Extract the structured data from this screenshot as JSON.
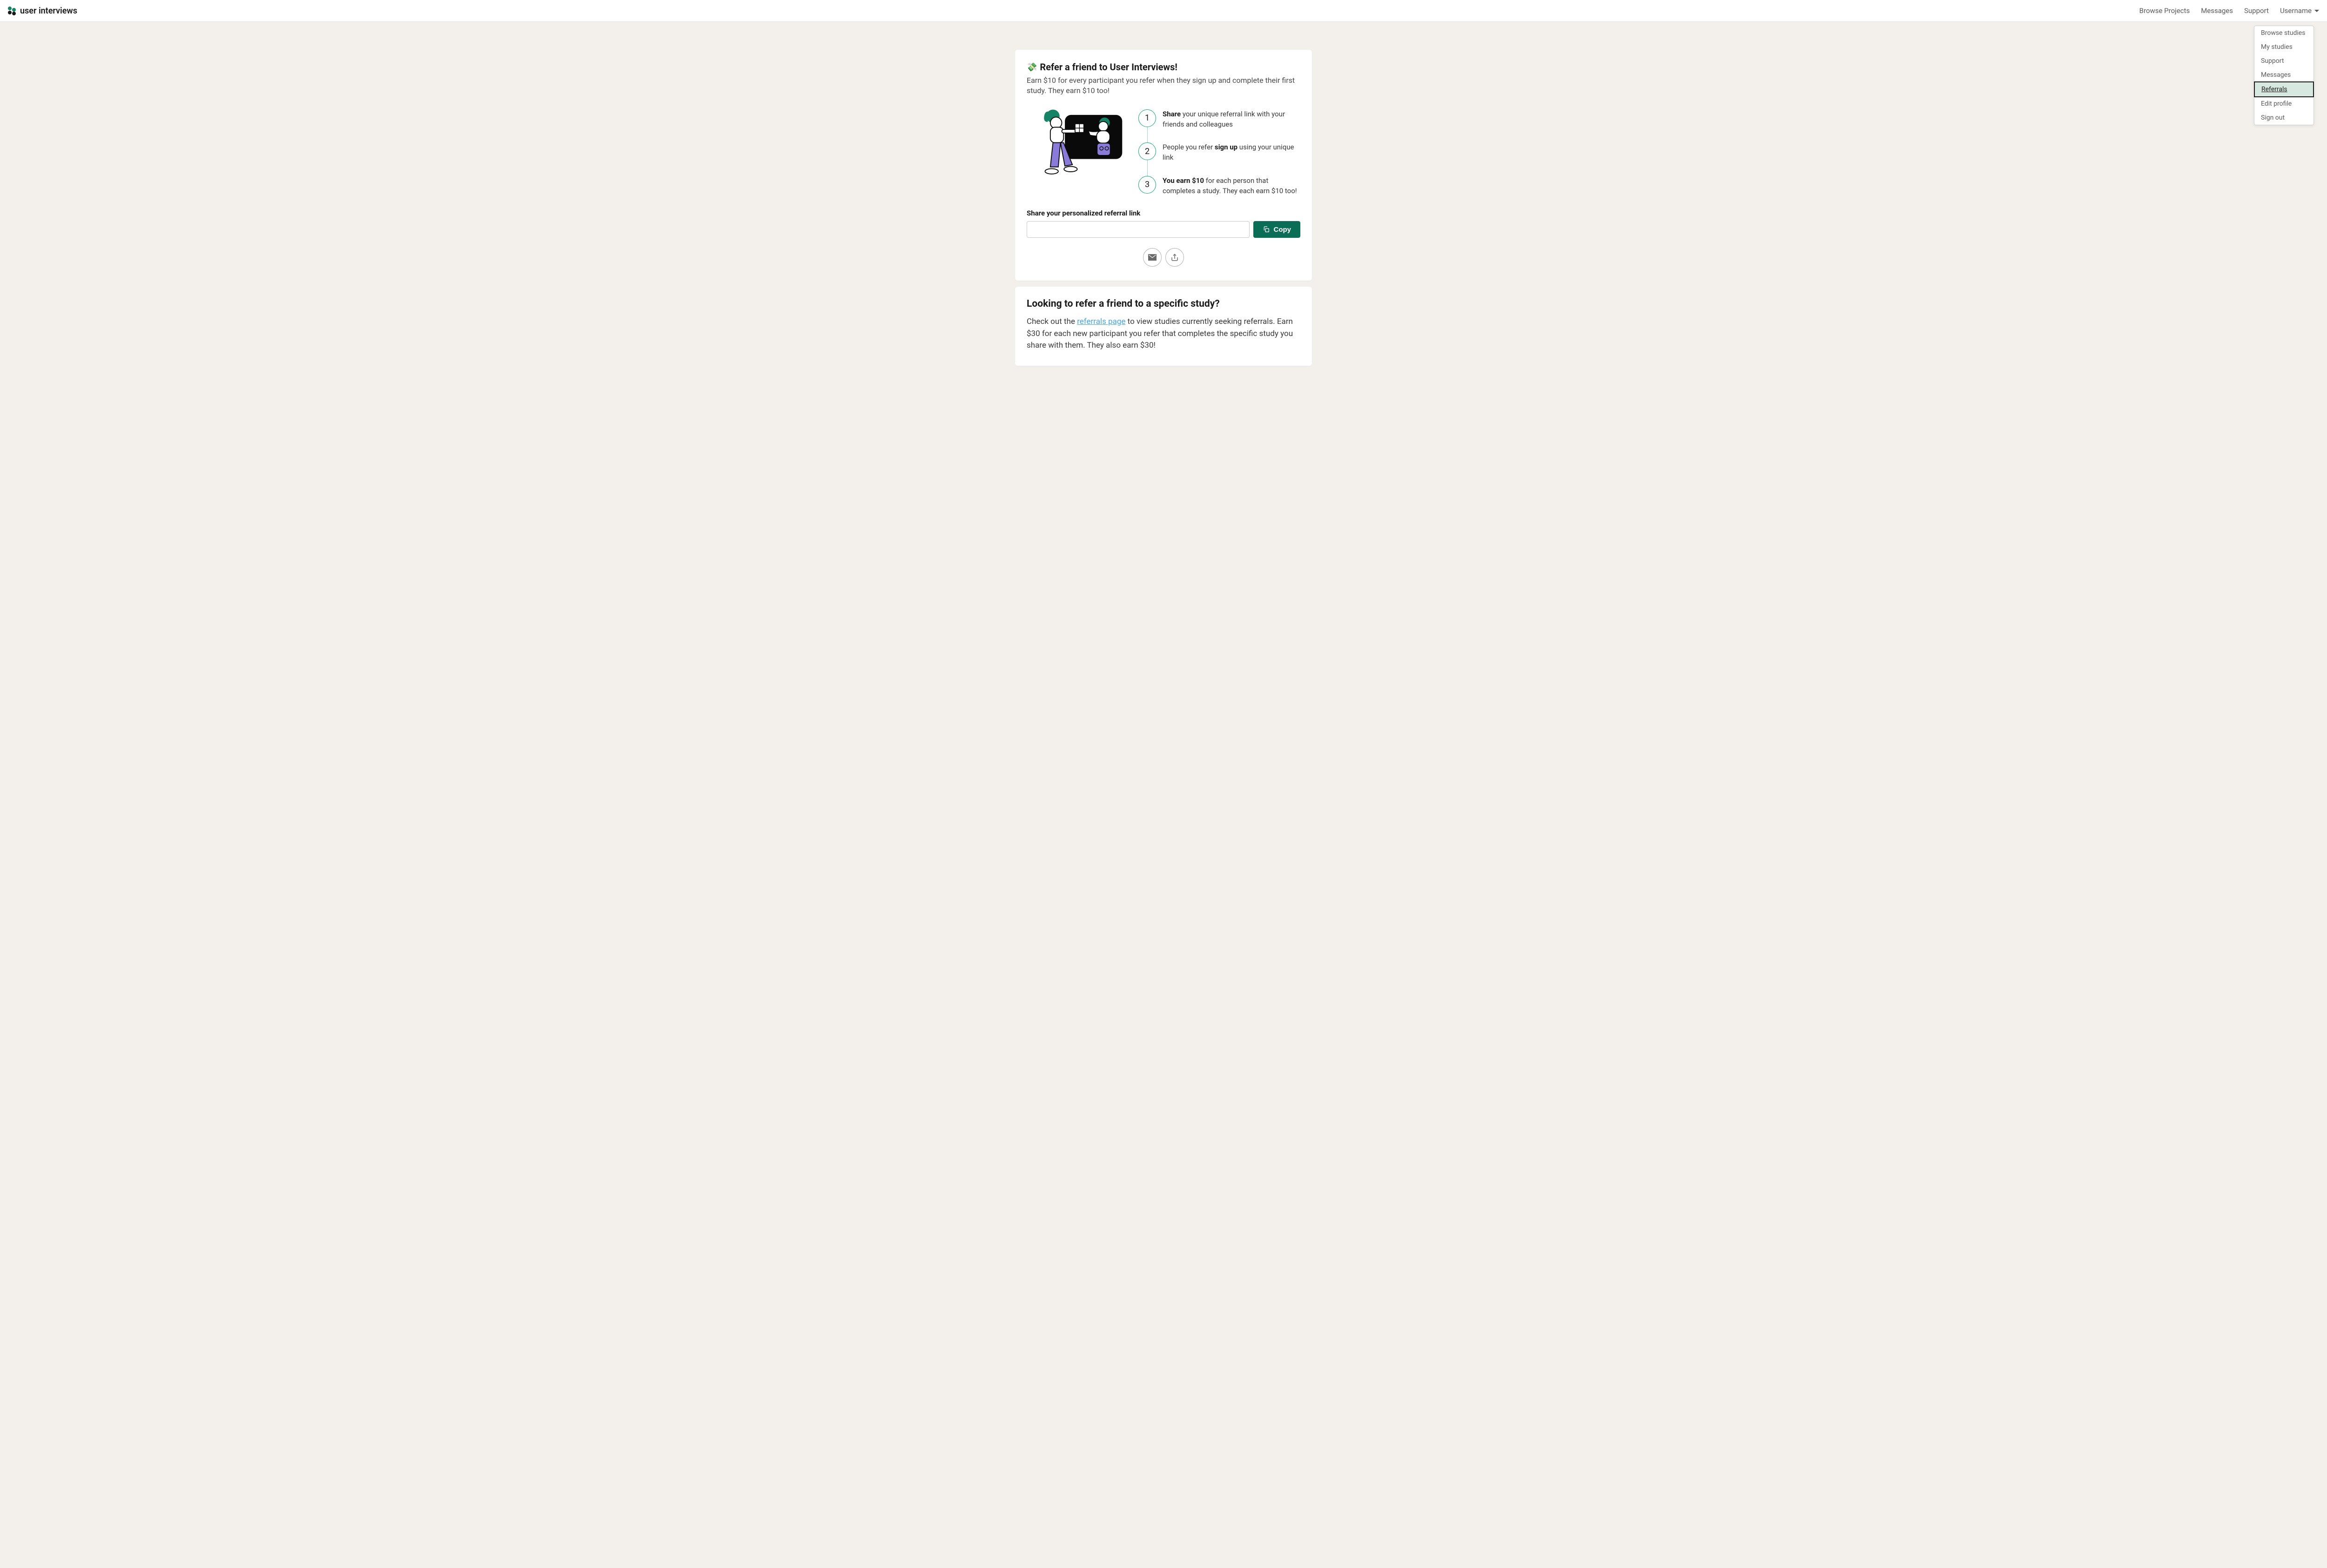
{
  "header": {
    "brand": "user interviews",
    "nav": {
      "browse_projects": "Browse Projects",
      "messages": "Messages",
      "support": "Support",
      "username": "Username"
    }
  },
  "dropdown": {
    "browse_studies": "Browse studies",
    "my_studies": "My studies",
    "support": "Support",
    "messages": "Messages",
    "referrals": "Referrals",
    "edit_profile": "Edit profile",
    "sign_out": "Sign out"
  },
  "card1": {
    "title": "Refer a friend to User Interviews!",
    "subtitle": "Earn $10 for every participant you refer when they sign up and complete their first study. They earn $10 too!",
    "steps": [
      {
        "num": "1",
        "bold": "Share",
        "rest": " your unique referral link with your friends and colleagues"
      },
      {
        "num": "2",
        "pre": "People you refer ",
        "bold": "sign up",
        "rest": " using your unique link"
      },
      {
        "num": "3",
        "bold": "You earn $10",
        "rest": " for each person that completes a study. They each earn $10 too!"
      }
    ],
    "share_label": "Share your personalized referral link",
    "copy_label": "Copy"
  },
  "card2": {
    "title": "Looking to refer a friend to a specific study?",
    "body_pre": "Check out the ",
    "link": "referrals page",
    "body_post": " to view studies currently seeking referrals. Earn $30 for each new participant you refer that completes the specific study you share with them. They also earn $30!"
  }
}
